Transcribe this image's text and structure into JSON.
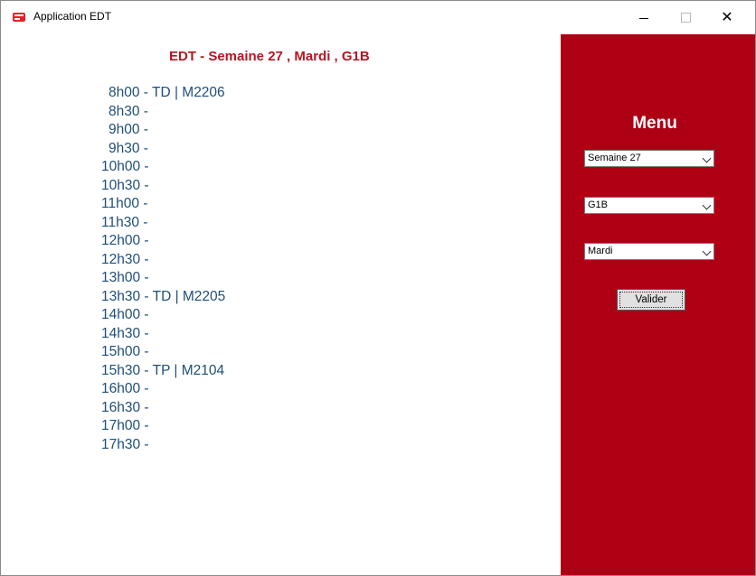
{
  "window": {
    "title": "Application EDT",
    "controls": {
      "minimize": "minimize",
      "maximize": "maximize",
      "close": "✕"
    }
  },
  "main": {
    "heading": "EDT - Semaine 27 , Mardi , G1B",
    "slots": [
      "8h00 - TD | M2206",
      "8h30 -",
      "9h00 -",
      "9h30 -",
      "10h00 -",
      "10h30 -",
      "11h00 -",
      "11h30 -",
      "12h00 -",
      "12h30 -",
      "13h00 -",
      "13h30 - TD | M2205",
      "14h00 -",
      "14h30 -",
      "15h00 -",
      "15h30 - TP | M2104",
      "16h00 -",
      "16h30 -",
      "17h00 -",
      "17h30 -"
    ]
  },
  "sidebar": {
    "title": "Menu",
    "week_select": "Semaine 27",
    "group_select": "G1B",
    "day_select": "Mardi",
    "validate_label": "Valider"
  },
  "colors": {
    "sidebar_bg": "#ad0014",
    "heading": "#b41723",
    "slot_text": "#1f4e79"
  },
  "icons": {
    "app": "app-calendar-icon",
    "dropdown": "chevron-down-icon"
  }
}
